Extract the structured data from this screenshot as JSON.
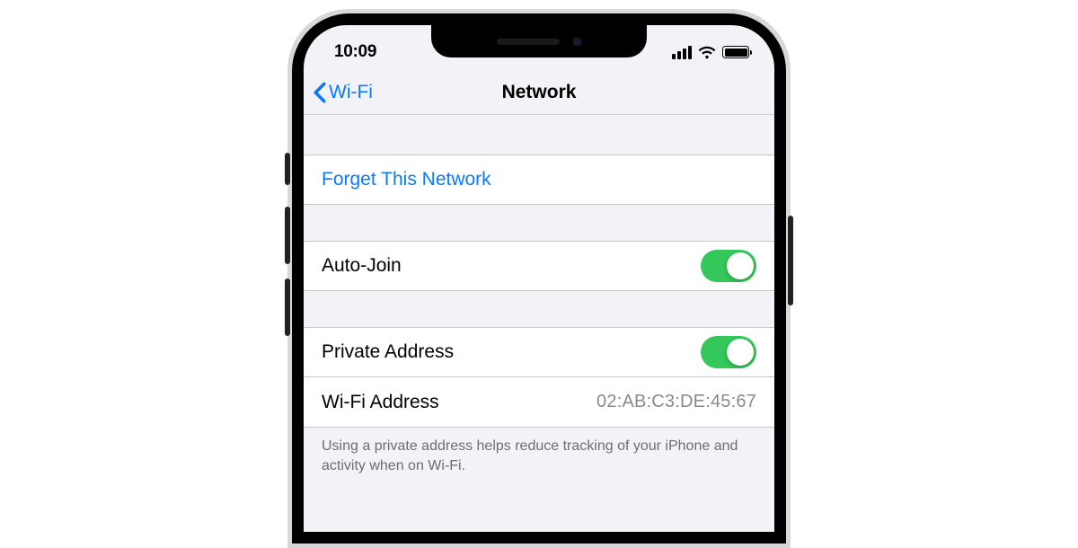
{
  "status": {
    "time": "10:09"
  },
  "nav": {
    "back_label": "Wi-Fi",
    "title": "Network"
  },
  "actions": {
    "forget_label": "Forget This Network"
  },
  "settings": {
    "auto_join": {
      "label": "Auto-Join",
      "on": true
    },
    "private_address": {
      "label": "Private Address",
      "on": true
    },
    "wifi_address": {
      "label": "Wi-Fi Address",
      "value": "02:AB:C3:DE:45:67"
    }
  },
  "footer": {
    "private_address_note": "Using a private address helps reduce tracking of your iPhone and activity when on Wi-Fi."
  }
}
